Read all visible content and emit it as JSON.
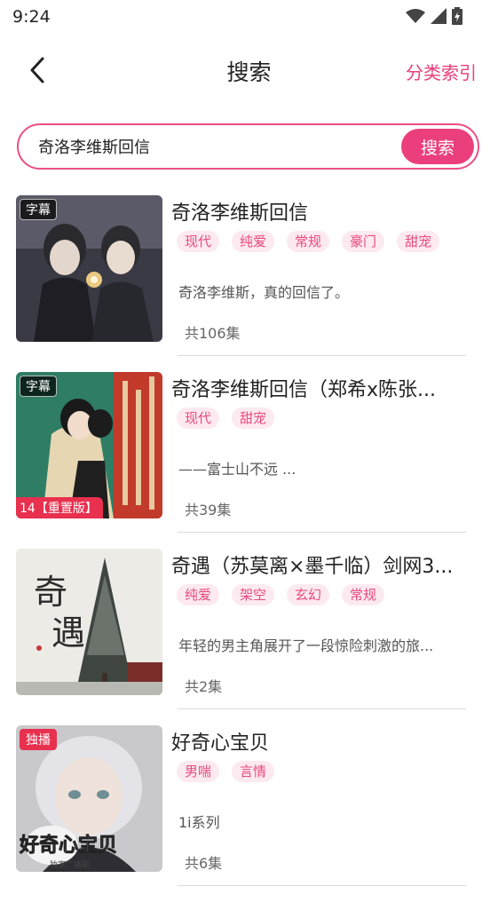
{
  "status_bar": {
    "time": "9:24"
  },
  "header": {
    "title": "搜索",
    "index_link": "分类索引"
  },
  "search": {
    "value": "奇洛李维斯回信",
    "button": "搜索"
  },
  "results": [
    {
      "title": "奇洛李维斯回信",
      "badge": "字幕",
      "tags": [
        "现代",
        "纯爱",
        "常规",
        "豪门",
        "甜宠"
      ],
      "description": "奇洛李维斯，真的回信了。",
      "episodes": "共106集"
    },
    {
      "title": "奇洛李维斯回信（郑希x陈张...",
      "badge": "字幕",
      "bottom_label": "14【重置版】",
      "tags": [
        "现代",
        "甜宠"
      ],
      "description": "——富士山不远 ...",
      "episodes": "共39集"
    },
    {
      "title": "奇遇（苏莫离×墨千临）剑网3...",
      "tags": [
        "纯爱",
        "架空",
        "玄幻",
        "常规"
      ],
      "description": "年轻的男主角展开了一段惊险刺激的旅...",
      "episodes": "共2集",
      "cover_text": "奇遇"
    },
    {
      "title": "好奇心宝贝",
      "badge": "独播",
      "tags": [
        "男喘",
        "言情"
      ],
      "description": "1i系列",
      "episodes": "共6集",
      "cover_text": "好奇心宝贝",
      "cover_subtext": "独家广播剧"
    }
  ]
}
